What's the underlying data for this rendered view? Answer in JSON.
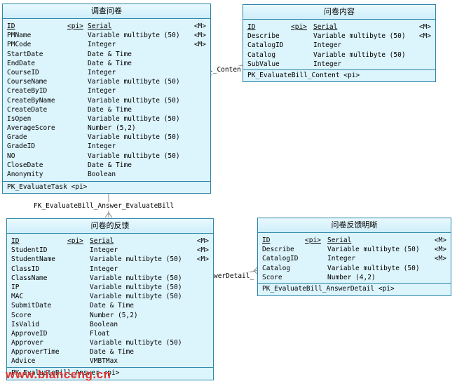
{
  "entities": {
    "task": {
      "title": "调查问卷",
      "attributes": [
        {
          "name": "ID",
          "key": "<pi>",
          "type": "Serial",
          "mand": "<M>",
          "pk": true
        },
        {
          "name": "PMName",
          "key": "",
          "type": "Variable multibyte (50)",
          "mand": "<M>",
          "pk": false
        },
        {
          "name": "PMCode",
          "key": "",
          "type": "Integer",
          "mand": "<M>",
          "pk": false
        },
        {
          "name": "StartDate",
          "key": "",
          "type": "Date & Time",
          "mand": "",
          "pk": false
        },
        {
          "name": "EndDate",
          "key": "",
          "type": "Date & Time",
          "mand": "",
          "pk": false
        },
        {
          "name": "CourseID",
          "key": "",
          "type": "Integer",
          "mand": "",
          "pk": false
        },
        {
          "name": "CourseName",
          "key": "",
          "type": "Variable multibyte (50)",
          "mand": "",
          "pk": false
        },
        {
          "name": "CreateByID",
          "key": "",
          "type": "Integer",
          "mand": "",
          "pk": false
        },
        {
          "name": "CreateByName",
          "key": "",
          "type": "Variable multibyte (50)",
          "mand": "",
          "pk": false
        },
        {
          "name": "CreateDate",
          "key": "",
          "type": "Date & Time",
          "mand": "",
          "pk": false
        },
        {
          "name": "IsOpen",
          "key": "",
          "type": "Variable multibyte (50)",
          "mand": "",
          "pk": false
        },
        {
          "name": "AverageScore",
          "key": "",
          "type": "Number (5,2)",
          "mand": "",
          "pk": false
        },
        {
          "name": "Grade",
          "key": "",
          "type": "Variable multibyte (50)",
          "mand": "",
          "pk": false
        },
        {
          "name": "GradeID",
          "key": "",
          "type": "Integer",
          "mand": "",
          "pk": false
        },
        {
          "name": "NO",
          "key": "",
          "type": "Variable multibyte (50)",
          "mand": "",
          "pk": false
        },
        {
          "name": "CloseDate",
          "key": "",
          "type": "Date & Time",
          "mand": "",
          "pk": false
        },
        {
          "name": "Anonymity",
          "key": "",
          "type": "Boolean",
          "mand": "",
          "pk": false
        }
      ],
      "key_line": "PK_EvaluateTask  <pi>"
    },
    "content": {
      "title": "问卷内容",
      "attributes": [
        {
          "name": "ID",
          "key": "<pi>",
          "type": "Serial",
          "mand": "<M>",
          "pk": true
        },
        {
          "name": "Describe",
          "key": "",
          "type": "Variable multibyte (50)",
          "mand": "<M>",
          "pk": false
        },
        {
          "name": "CatalogID",
          "key": "",
          "type": "Integer",
          "mand": "",
          "pk": false
        },
        {
          "name": "Catalog",
          "key": "",
          "type": "Variable multibyte (50)",
          "mand": "",
          "pk": false
        },
        {
          "name": "SubValue",
          "key": "",
          "type": "Integer",
          "mand": "",
          "pk": false
        }
      ],
      "key_line": "PK_EvaluateBill_Content  <pi>"
    },
    "answer": {
      "title": "问卷的反馈",
      "attributes": [
        {
          "name": "ID",
          "key": "<pi>",
          "type": "Serial",
          "mand": "<M>",
          "pk": true
        },
        {
          "name": "StudentID",
          "key": "",
          "type": "Integer",
          "mand": "<M>",
          "pk": false
        },
        {
          "name": "StudentName",
          "key": "",
          "type": "Variable multibyte (50)",
          "mand": "<M>",
          "pk": false
        },
        {
          "name": "ClassID",
          "key": "",
          "type": "Integer",
          "mand": "",
          "pk": false
        },
        {
          "name": "ClassName",
          "key": "",
          "type": "Variable multibyte (50)",
          "mand": "",
          "pk": false
        },
        {
          "name": "IP",
          "key": "",
          "type": "Variable multibyte (50)",
          "mand": "",
          "pk": false
        },
        {
          "name": "MAC",
          "key": "",
          "type": "Variable multibyte (50)",
          "mand": "",
          "pk": false
        },
        {
          "name": "SubmitDate",
          "key": "",
          "type": "Date & Time",
          "mand": "",
          "pk": false
        },
        {
          "name": "Score",
          "key": "",
          "type": "Number (5,2)",
          "mand": "",
          "pk": false
        },
        {
          "name": "IsValid",
          "key": "",
          "type": "Boolean",
          "mand": "",
          "pk": false
        },
        {
          "name": "ApproveID",
          "key": "",
          "type": "Float",
          "mand": "",
          "pk": false
        },
        {
          "name": "Approver",
          "key": "",
          "type": "Variable multibyte (50)",
          "mand": "",
          "pk": false
        },
        {
          "name": "ApproverTime",
          "key": "",
          "type": "Date & Time",
          "mand": "",
          "pk": false
        },
        {
          "name": "Advice",
          "key": "",
          "type": "VMBTMax",
          "mand": "",
          "pk": false
        }
      ],
      "key_line": "PK_EvaluateBill_Answer  <pi>"
    },
    "detail": {
      "title": "问卷反馈明晰",
      "attributes": [
        {
          "name": "ID",
          "key": "<pi>",
          "type": "Serial",
          "mand": "<M>",
          "pk": true
        },
        {
          "name": "Describe",
          "key": "",
          "type": "Variable multibyte (50)",
          "mand": "<M>",
          "pk": false
        },
        {
          "name": "CatalogID",
          "key": "",
          "type": "Integer",
          "mand": "<M>",
          "pk": false
        },
        {
          "name": "Catalog",
          "key": "",
          "type": "Variable multibyte (50)",
          "mand": "",
          "pk": false
        },
        {
          "name": "Score",
          "key": "",
          "type": "Number (4,2)",
          "mand": "",
          "pk": false
        }
      ],
      "key_line": "PK_EvaluateBill_AnswerDetail  <pi>"
    }
  },
  "relations": {
    "content": "l_Conten",
    "answer": "FK_EvaluateBill_Answer_EvaluateBill",
    "detail": "werDetail_"
  },
  "watermark": "www.bianceng.cn",
  "colors": {
    "entity_fill": "#dcf4fc",
    "entity_border": "#2e86a8",
    "connector": "#8a8a8a",
    "watermark": "#e0342e"
  }
}
